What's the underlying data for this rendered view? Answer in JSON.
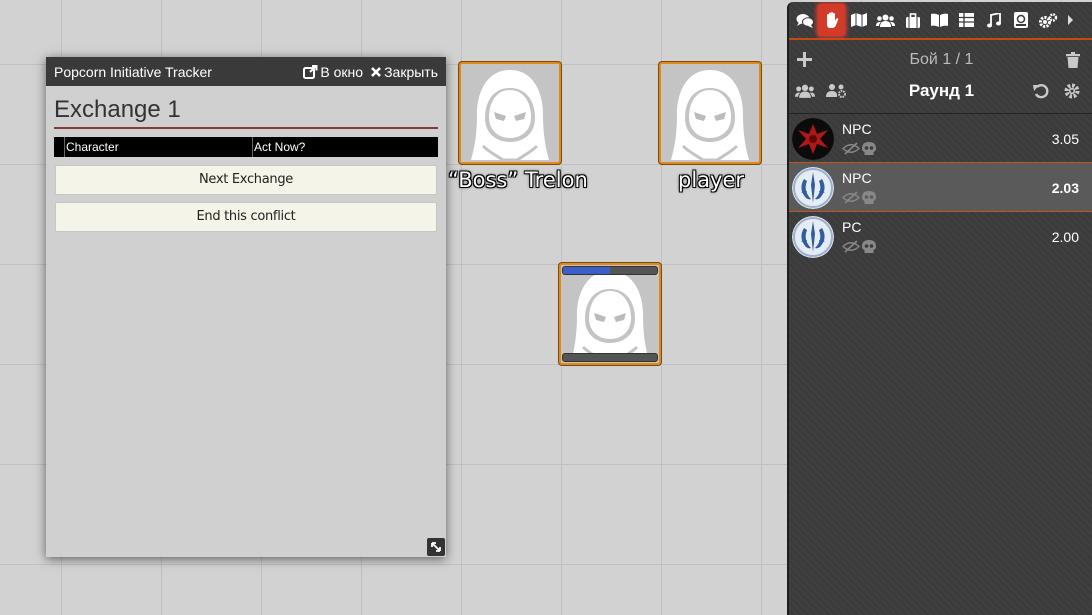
{
  "tracker": {
    "window_title": "Popcorn Initiative Tracker",
    "popout_label": "В окно",
    "close_label": "Закрыть",
    "exchange_title": "Exchange 1",
    "columns": [
      "",
      "Character",
      "Act Now?"
    ],
    "next_exchange_label": "Next Exchange",
    "end_conflict_label": "End this conflict"
  },
  "tokens": [
    {
      "name": "“Boss” Trelon",
      "icon": "hooded-figure-icon"
    },
    {
      "name": "player",
      "icon": "hooded-figure-icon"
    },
    {
      "name": "",
      "icon": "hooded-figure-icon",
      "bar_fill_fraction": 0.5
    }
  ],
  "sidebar": {
    "tabs": [
      "chat-icon",
      "hand-icon",
      "map-icon",
      "users-icon",
      "briefcase-icon",
      "book-icon",
      "table-icon",
      "music-icon",
      "compendium-icon",
      "settings-icon"
    ],
    "active_tab": "hand-icon",
    "fight_label": "Бой 1 / 1",
    "round_label": "Раунд 1",
    "turn_order": [
      {
        "name": "NPC",
        "value": "3.05",
        "avatar": "red-emblem-icon"
      },
      {
        "name": "NPC",
        "value": "2.03",
        "avatar": "jedi-emblem-icon"
      },
      {
        "name": "PC",
        "value": "2.00",
        "avatar": "jedi-emblem-icon"
      }
    ]
  },
  "colors": {
    "accent_orange": "#e08a1e",
    "active_tab_red": "#d23a2a",
    "exchange_underline": "#8b3a3a",
    "bar_blue": "#3b5fc8"
  }
}
